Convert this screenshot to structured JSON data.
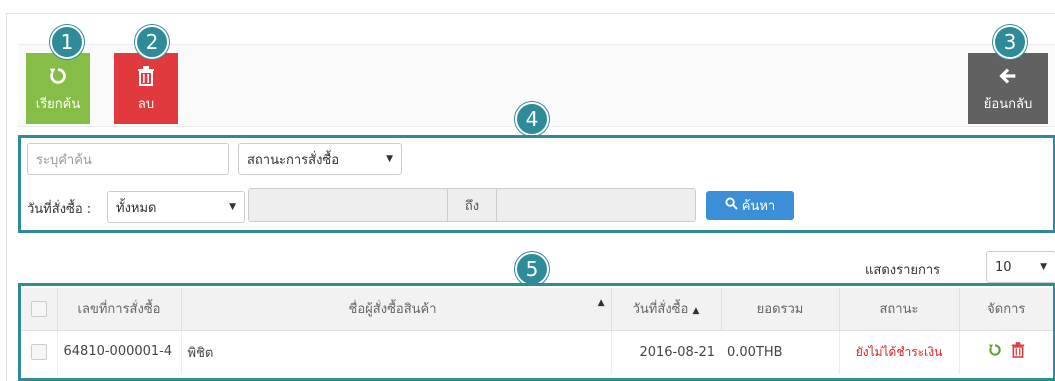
{
  "toolbar": {
    "refresh_label": "เรียกค้น",
    "delete_label": "ลบ",
    "back_label": "ย้อนกลับ"
  },
  "badges": [
    "1",
    "2",
    "3",
    "4",
    "5"
  ],
  "search": {
    "keyword_placeholder": "ระบุคำค้น",
    "status_select": "สถานะการสั่งซื้อ",
    "date_label": "วันที่สั่งซื้อ :",
    "date_select": "ทั้งหมด",
    "to_label": "ถึง",
    "search_button": "ค้นหา"
  },
  "pagination": {
    "show_label": "แสดงรายการ",
    "page_size": "10"
  },
  "table": {
    "headers": {
      "order_no": "เลขที่การสั่งซื้อ",
      "buyer": "ชื่อผู้สั่งซื้อสินค้า",
      "date": "วันที่สั่งซื้อ",
      "total": "ยอดรวม",
      "status": "สถานะ",
      "manage": "จัดการ"
    },
    "rows": [
      {
        "order_no": "64810-000001-4",
        "buyer": "พิชิต",
        "date": "2016-08-21",
        "total": "0.00THB",
        "status": "ยังไม่ได้ชำระเงิน"
      }
    ]
  },
  "colors": {
    "accent": "#2e8c99",
    "refresh": "#86bd47",
    "delete": "#e0393e",
    "back": "#616161",
    "search_btn": "#3b8fd8",
    "status_unpaid": "#e02020"
  }
}
